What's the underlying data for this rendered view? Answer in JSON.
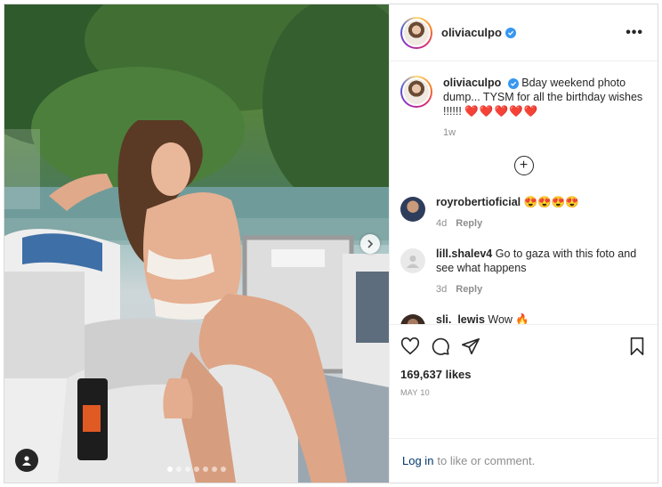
{
  "header": {
    "username": "oliviaculpo",
    "more_label": "•••"
  },
  "caption": {
    "username": "oliviaculpo",
    "text": "Bday weekend photo dump... TYSM for all the birthday wishes !!!!!!",
    "hearts": "❤️❤️❤️❤️❤️",
    "time": "1w"
  },
  "load_more_label": "+",
  "comments": [
    {
      "username": "royrobertioficial",
      "text": "😍😍😍😍",
      "time": "4d",
      "reply": "Reply"
    },
    {
      "username": "lill.shalev4",
      "text": "Go to gaza with this foto and see what happens",
      "time": "3d",
      "reply": "Reply"
    },
    {
      "username": "sli._lewis",
      "text": "Wow 🔥",
      "time": "",
      "reply": ""
    }
  ],
  "likes": "169,637 likes",
  "date": "MAY 10",
  "login": {
    "link": "Log in",
    "rest": "to like or comment."
  },
  "carousel": {
    "count": 7,
    "active": 0
  },
  "colors": {
    "verified": "#3897f0",
    "link": "#00376b",
    "meta": "#8e8e8e"
  },
  "icons": [
    "heart-icon",
    "comment-icon",
    "share-icon",
    "bookmark-icon",
    "user-tag-icon",
    "next-arrow-icon",
    "verified-icon",
    "more-options-icon"
  ]
}
